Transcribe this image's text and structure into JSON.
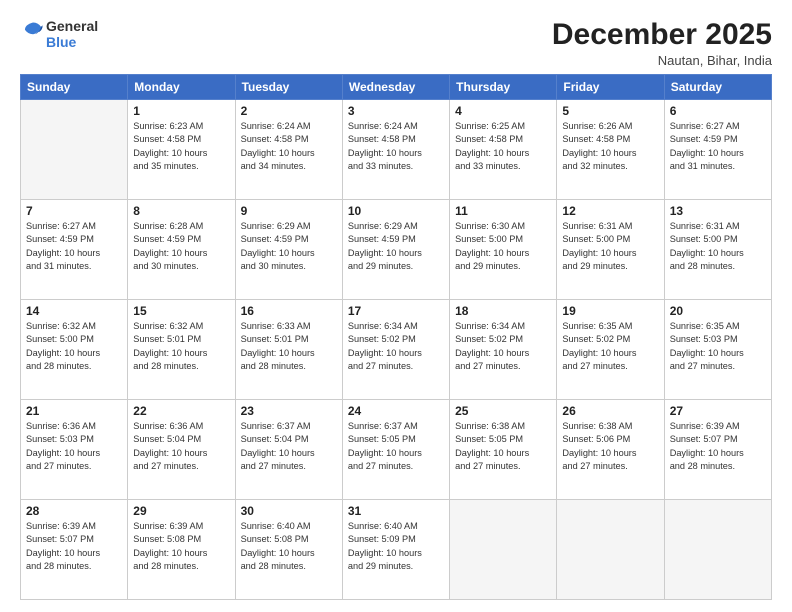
{
  "logo": {
    "line1": "General",
    "line2": "Blue"
  },
  "header": {
    "month": "December 2025",
    "location": "Nautan, Bihar, India"
  },
  "weekdays": [
    "Sunday",
    "Monday",
    "Tuesday",
    "Wednesday",
    "Thursday",
    "Friday",
    "Saturday"
  ],
  "weeks": [
    [
      {
        "day": "",
        "info": ""
      },
      {
        "day": "1",
        "info": "Sunrise: 6:23 AM\nSunset: 4:58 PM\nDaylight: 10 hours\nand 35 minutes."
      },
      {
        "day": "2",
        "info": "Sunrise: 6:24 AM\nSunset: 4:58 PM\nDaylight: 10 hours\nand 34 minutes."
      },
      {
        "day": "3",
        "info": "Sunrise: 6:24 AM\nSunset: 4:58 PM\nDaylight: 10 hours\nand 33 minutes."
      },
      {
        "day": "4",
        "info": "Sunrise: 6:25 AM\nSunset: 4:58 PM\nDaylight: 10 hours\nand 33 minutes."
      },
      {
        "day": "5",
        "info": "Sunrise: 6:26 AM\nSunset: 4:58 PM\nDaylight: 10 hours\nand 32 minutes."
      },
      {
        "day": "6",
        "info": "Sunrise: 6:27 AM\nSunset: 4:59 PM\nDaylight: 10 hours\nand 31 minutes."
      }
    ],
    [
      {
        "day": "7",
        "info": "Sunrise: 6:27 AM\nSunset: 4:59 PM\nDaylight: 10 hours\nand 31 minutes."
      },
      {
        "day": "8",
        "info": "Sunrise: 6:28 AM\nSunset: 4:59 PM\nDaylight: 10 hours\nand 30 minutes."
      },
      {
        "day": "9",
        "info": "Sunrise: 6:29 AM\nSunset: 4:59 PM\nDaylight: 10 hours\nand 30 minutes."
      },
      {
        "day": "10",
        "info": "Sunrise: 6:29 AM\nSunset: 4:59 PM\nDaylight: 10 hours\nand 29 minutes."
      },
      {
        "day": "11",
        "info": "Sunrise: 6:30 AM\nSunset: 5:00 PM\nDaylight: 10 hours\nand 29 minutes."
      },
      {
        "day": "12",
        "info": "Sunrise: 6:31 AM\nSunset: 5:00 PM\nDaylight: 10 hours\nand 29 minutes."
      },
      {
        "day": "13",
        "info": "Sunrise: 6:31 AM\nSunset: 5:00 PM\nDaylight: 10 hours\nand 28 minutes."
      }
    ],
    [
      {
        "day": "14",
        "info": "Sunrise: 6:32 AM\nSunset: 5:00 PM\nDaylight: 10 hours\nand 28 minutes."
      },
      {
        "day": "15",
        "info": "Sunrise: 6:32 AM\nSunset: 5:01 PM\nDaylight: 10 hours\nand 28 minutes."
      },
      {
        "day": "16",
        "info": "Sunrise: 6:33 AM\nSunset: 5:01 PM\nDaylight: 10 hours\nand 28 minutes."
      },
      {
        "day": "17",
        "info": "Sunrise: 6:34 AM\nSunset: 5:02 PM\nDaylight: 10 hours\nand 27 minutes."
      },
      {
        "day": "18",
        "info": "Sunrise: 6:34 AM\nSunset: 5:02 PM\nDaylight: 10 hours\nand 27 minutes."
      },
      {
        "day": "19",
        "info": "Sunrise: 6:35 AM\nSunset: 5:02 PM\nDaylight: 10 hours\nand 27 minutes."
      },
      {
        "day": "20",
        "info": "Sunrise: 6:35 AM\nSunset: 5:03 PM\nDaylight: 10 hours\nand 27 minutes."
      }
    ],
    [
      {
        "day": "21",
        "info": "Sunrise: 6:36 AM\nSunset: 5:03 PM\nDaylight: 10 hours\nand 27 minutes."
      },
      {
        "day": "22",
        "info": "Sunrise: 6:36 AM\nSunset: 5:04 PM\nDaylight: 10 hours\nand 27 minutes."
      },
      {
        "day": "23",
        "info": "Sunrise: 6:37 AM\nSunset: 5:04 PM\nDaylight: 10 hours\nand 27 minutes."
      },
      {
        "day": "24",
        "info": "Sunrise: 6:37 AM\nSunset: 5:05 PM\nDaylight: 10 hours\nand 27 minutes."
      },
      {
        "day": "25",
        "info": "Sunrise: 6:38 AM\nSunset: 5:05 PM\nDaylight: 10 hours\nand 27 minutes."
      },
      {
        "day": "26",
        "info": "Sunrise: 6:38 AM\nSunset: 5:06 PM\nDaylight: 10 hours\nand 27 minutes."
      },
      {
        "day": "27",
        "info": "Sunrise: 6:39 AM\nSunset: 5:07 PM\nDaylight: 10 hours\nand 28 minutes."
      }
    ],
    [
      {
        "day": "28",
        "info": "Sunrise: 6:39 AM\nSunset: 5:07 PM\nDaylight: 10 hours\nand 28 minutes."
      },
      {
        "day": "29",
        "info": "Sunrise: 6:39 AM\nSunset: 5:08 PM\nDaylight: 10 hours\nand 28 minutes."
      },
      {
        "day": "30",
        "info": "Sunrise: 6:40 AM\nSunset: 5:08 PM\nDaylight: 10 hours\nand 28 minutes."
      },
      {
        "day": "31",
        "info": "Sunrise: 6:40 AM\nSunset: 5:09 PM\nDaylight: 10 hours\nand 29 minutes."
      },
      {
        "day": "",
        "info": ""
      },
      {
        "day": "",
        "info": ""
      },
      {
        "day": "",
        "info": ""
      }
    ]
  ]
}
